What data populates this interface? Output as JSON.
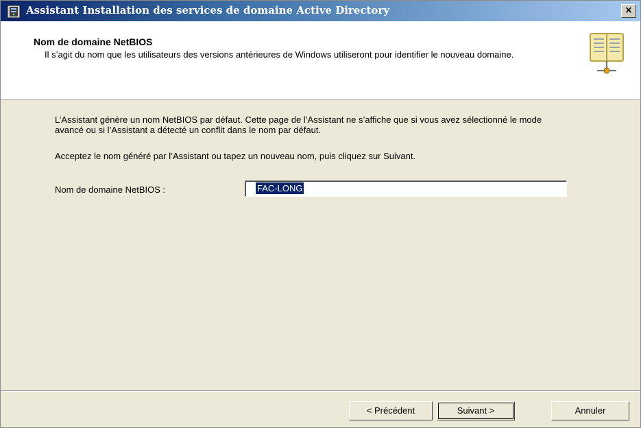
{
  "window": {
    "title": "Assistant Installation des services de domaine Active Directory",
    "close_label": "×"
  },
  "header": {
    "title": "Nom de domaine NetBIOS",
    "description": "Il s’agit du nom que les utilisateurs des versions antérieures de Windows utiliseront pour identifier le nouveau domaine."
  },
  "body": {
    "paragraph1": "L’Assistant génère un nom NetBIOS par défaut. Cette page de l’Assistant ne s’affiche que si vous avez sélectionné le mode avancé ou si l’Assistant a détecté un conflit dans le nom par défaut.",
    "paragraph2": "Acceptez le nom généré par l’Assistant ou tapez un nouveau nom, puis cliquez sur Suivant.",
    "field_label": "Nom de domaine NetBIOS :",
    "field_value": "FAC-LONG"
  },
  "buttons": {
    "previous": "< Précédent",
    "next": "Suivant >",
    "cancel": "Annuler"
  },
  "icons": {
    "title_icon": "server-icon",
    "header_icon": "book-directory-icon",
    "close": "close-icon"
  },
  "colors": {
    "titlebar_start": "#0a246a",
    "titlebar_end": "#a6caf0",
    "selection": "#0a246a",
    "dialog_bg": "#ece9d8"
  }
}
